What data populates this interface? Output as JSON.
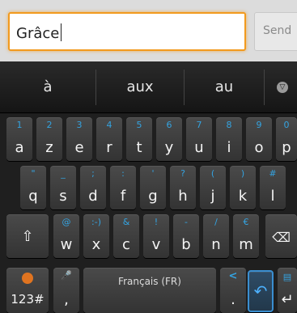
{
  "compose": {
    "input_value": "Grâce",
    "send_label": "Send"
  },
  "suggestions": [
    "à",
    "aux",
    "au"
  ],
  "keyboard": {
    "row1": [
      {
        "hint": "1",
        "label": "a"
      },
      {
        "hint": "2",
        "label": "z"
      },
      {
        "hint": "3",
        "label": "e"
      },
      {
        "hint": "4",
        "label": "r"
      },
      {
        "hint": "5",
        "label": "t"
      },
      {
        "hint": "6",
        "label": "y"
      },
      {
        "hint": "7",
        "label": "u"
      },
      {
        "hint": "8",
        "label": "i"
      },
      {
        "hint": "9",
        "label": "o"
      },
      {
        "hint": "0",
        "label": "p"
      }
    ],
    "row2": [
      {
        "hint": "\"",
        "label": "q"
      },
      {
        "hint": "_",
        "label": "s"
      },
      {
        "hint": ";",
        "label": "d"
      },
      {
        "hint": ":",
        "label": "f"
      },
      {
        "hint": "'",
        "label": "g"
      },
      {
        "hint": "?",
        "label": "h"
      },
      {
        "hint": "(",
        "label": "j"
      },
      {
        "hint": ")",
        "label": "k"
      },
      {
        "hint": "#",
        "label": "l"
      }
    ],
    "row3": [
      {
        "hint": "@",
        "label": "w"
      },
      {
        "hint": ":-)",
        "label": "x"
      },
      {
        "hint": "&",
        "label": "c"
      },
      {
        "hint": "!",
        "label": "v"
      },
      {
        "hint": "-",
        "label": "b"
      },
      {
        "hint": "/",
        "label": "n"
      },
      {
        "hint": "€",
        "label": "m"
      }
    ],
    "shift_glyph": "⇧",
    "backspace_glyph": "⌫",
    "symbols_label": "123#",
    "comma_label": ",",
    "space_label": "Français (FR)",
    "period_label": ".",
    "enter_glyph": "↵",
    "undo_glyph": "↶",
    "mic_glyph": "🎤",
    "share_glyph": "<",
    "expand_glyph": "▽"
  }
}
